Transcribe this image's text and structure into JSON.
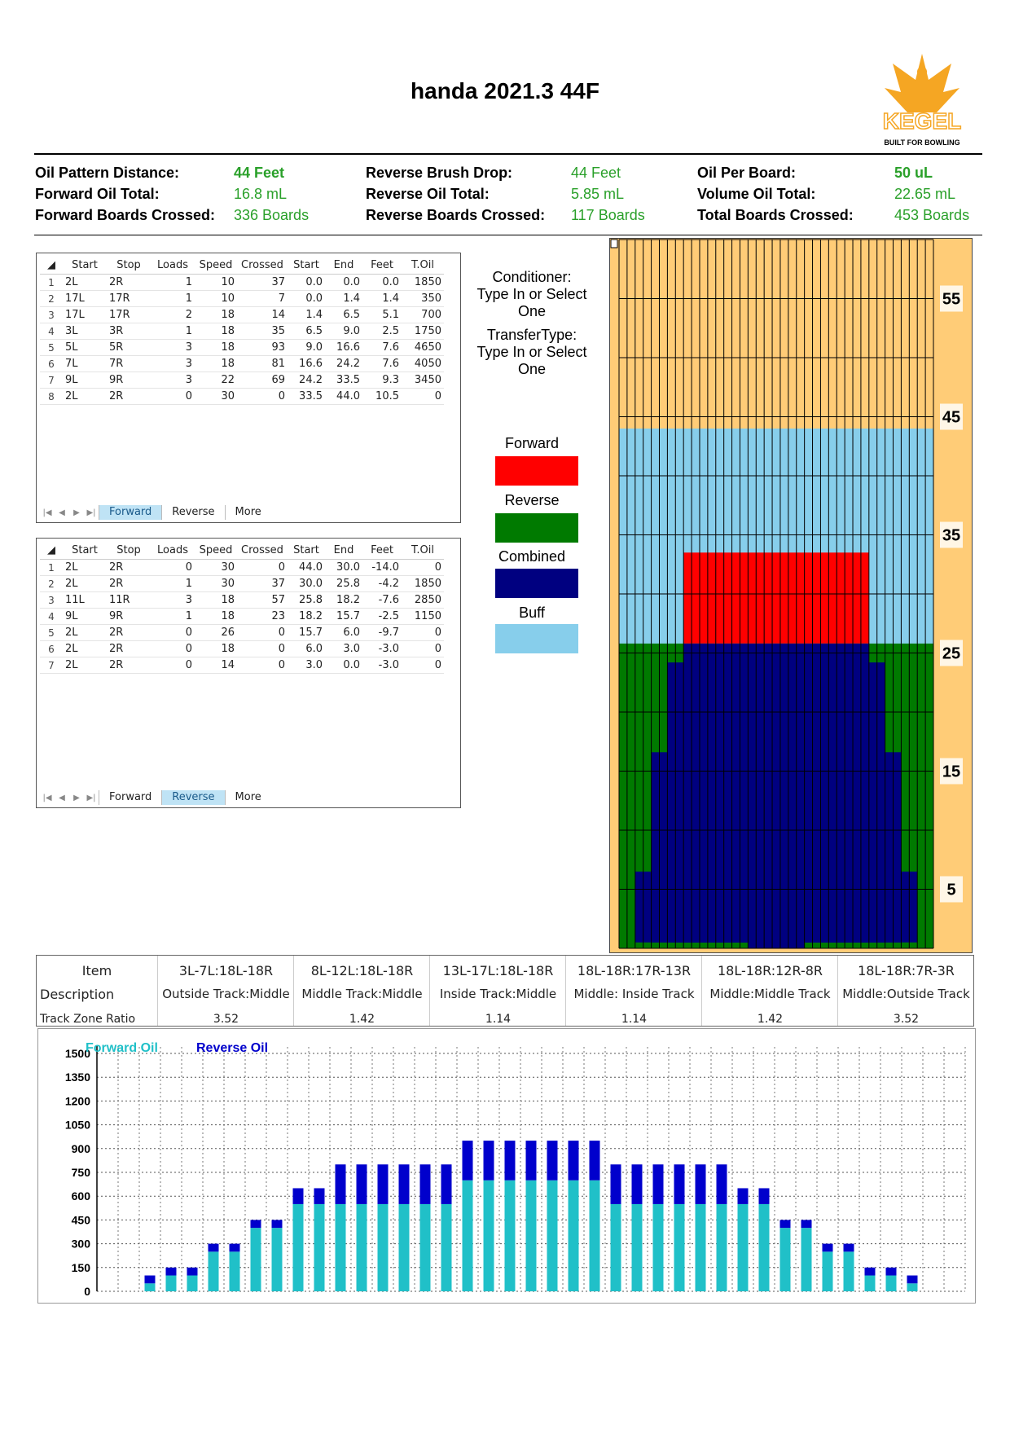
{
  "title": "handa 2021.3 44F",
  "logo": {
    "text": "KEGEL",
    "tagline": "BUILT FOR BOWLING",
    "icon": "eagle-icon",
    "color": "#f5a623"
  },
  "stats": {
    "col1": [
      {
        "label": "Oil Pattern Distance:",
        "value": "44 Feet"
      },
      {
        "label": "Forward Oil Total:",
        "value": "16.8 mL"
      },
      {
        "label": "Forward Boards Crossed:",
        "value": "336 Boards"
      }
    ],
    "col2": [
      {
        "label": "Reverse Brush Drop:",
        "value": "44 Feet"
      },
      {
        "label": "Reverse Oil Total:",
        "value": "5.85 mL"
      },
      {
        "label": "Reverse Boards Crossed:",
        "value": "117 Boards"
      }
    ],
    "col3": [
      {
        "label": "Oil Per Board:",
        "value": "50 uL"
      },
      {
        "label": "Volume Oil Total:",
        "value": "22.65 mL"
      },
      {
        "label": "Total Boards Crossed:",
        "value": "453 Boards"
      }
    ]
  },
  "table_headers": [
    "Start",
    "Stop",
    "Loads",
    "Speed",
    "Crossed",
    "Start",
    "End",
    "Feet",
    "T.Oil"
  ],
  "forward_table": [
    [
      "2L",
      "2R",
      "1",
      "10",
      "37",
      "0.0",
      "0.0",
      "0.0",
      "1850"
    ],
    [
      "17L",
      "17R",
      "1",
      "10",
      "7",
      "0.0",
      "1.4",
      "1.4",
      "350"
    ],
    [
      "17L",
      "17R",
      "2",
      "18",
      "14",
      "1.4",
      "6.5",
      "5.1",
      "700"
    ],
    [
      "3L",
      "3R",
      "1",
      "18",
      "35",
      "6.5",
      "9.0",
      "2.5",
      "1750"
    ],
    [
      "5L",
      "5R",
      "3",
      "18",
      "93",
      "9.0",
      "16.6",
      "7.6",
      "4650"
    ],
    [
      "7L",
      "7R",
      "3",
      "18",
      "81",
      "16.6",
      "24.2",
      "7.6",
      "4050"
    ],
    [
      "9L",
      "9R",
      "3",
      "22",
      "69",
      "24.2",
      "33.5",
      "9.3",
      "3450"
    ],
    [
      "2L",
      "2R",
      "0",
      "30",
      "0",
      "33.5",
      "44.0",
      "10.5",
      "0"
    ]
  ],
  "reverse_table": [
    [
      "2L",
      "2R",
      "0",
      "30",
      "0",
      "44.0",
      "30.0",
      "-14.0",
      "0"
    ],
    [
      "2L",
      "2R",
      "1",
      "30",
      "37",
      "30.0",
      "25.8",
      "-4.2",
      "1850"
    ],
    [
      "11L",
      "11R",
      "3",
      "18",
      "57",
      "25.8",
      "18.2",
      "-7.6",
      "2850"
    ],
    [
      "9L",
      "9R",
      "1",
      "18",
      "23",
      "18.2",
      "15.7",
      "-2.5",
      "1150"
    ],
    [
      "2L",
      "2R",
      "0",
      "26",
      "0",
      "15.7",
      "6.0",
      "-9.7",
      "0"
    ],
    [
      "2L",
      "2R",
      "0",
      "18",
      "0",
      "6.0",
      "3.0",
      "-3.0",
      "0"
    ],
    [
      "2L",
      "2R",
      "0",
      "14",
      "0",
      "3.0",
      "0.0",
      "-3.0",
      "0"
    ]
  ],
  "sheet_tabs": [
    "Forward",
    "Reverse",
    "More"
  ],
  "conditioner": {
    "line1": "Conditioner:",
    "line2": "Type In or Select",
    "line3": "One"
  },
  "transfer": {
    "line1": "TransferType:",
    "line2": "Type In or Select",
    "line3": "One"
  },
  "legend": [
    {
      "label": "Forward",
      "color": "#ff0000"
    },
    {
      "label": "Reverse",
      "color": "#007a00"
    },
    {
      "label": "Combined",
      "color": "#000080"
    },
    {
      "label": "Buff",
      "color": "#87ceeb"
    }
  ],
  "lane": {
    "distance_labels": [
      "55",
      "45",
      "35",
      "25",
      "15",
      "5"
    ],
    "max_feet": 60,
    "boards": 39,
    "colors": {
      "dry": "#ffcc77",
      "buff": "#87ceeb",
      "forward": "#ff0000",
      "reverse": "#007a00",
      "combined": "#000080"
    }
  },
  "zones": {
    "row_labels": [
      "Item",
      "Description",
      "Track Zone Ratio"
    ],
    "columns": [
      {
        "item": "3L-7L:18L-18R",
        "desc": "Outside Track:Middle",
        "ratio": "3.52"
      },
      {
        "item": "8L-12L:18L-18R",
        "desc": "Middle Track:Middle",
        "ratio": "1.42"
      },
      {
        "item": "13L-17L:18L-18R",
        "desc": "Inside Track:Middle",
        "ratio": "1.14"
      },
      {
        "item": "18L-18R:17R-13R",
        "desc": "Middle: Inside Track",
        "ratio": "1.14"
      },
      {
        "item": "18L-18R:12R-8R",
        "desc": "Middle:Middle Track",
        "ratio": "1.42"
      },
      {
        "item": "18L-18R:7R-3R",
        "desc": "Middle:Outside Track",
        "ratio": "3.52"
      }
    ]
  },
  "chart_data": {
    "type": "bar",
    "stacked": true,
    "series": [
      {
        "name": "Forward Oil",
        "color": "#20c0c8",
        "values": [
          0,
          0,
          50,
          100,
          100,
          250,
          250,
          400,
          400,
          550,
          550,
          550,
          550,
          550,
          550,
          550,
          550,
          700,
          700,
          700,
          700,
          700,
          700,
          700,
          550,
          550,
          550,
          550,
          550,
          550,
          550,
          550,
          400,
          400,
          250,
          250,
          100,
          100,
          50,
          0,
          0
        ]
      },
      {
        "name": "Reverse Oil",
        "color": "#0000cc",
        "values": [
          0,
          0,
          50,
          50,
          50,
          50,
          50,
          50,
          50,
          100,
          100,
          250,
          250,
          250,
          250,
          250,
          250,
          250,
          250,
          250,
          250,
          250,
          250,
          250,
          250,
          250,
          250,
          250,
          250,
          250,
          100,
          100,
          50,
          50,
          50,
          50,
          50,
          50,
          50,
          0,
          0
        ]
      }
    ],
    "ylim": [
      0,
      1500
    ],
    "yticks": [
      "1500",
      "1350",
      "1200",
      "1050",
      "900",
      "750",
      "600",
      "450",
      "300",
      "150",
      "0"
    ],
    "grid": true,
    "legend": "top-left"
  }
}
